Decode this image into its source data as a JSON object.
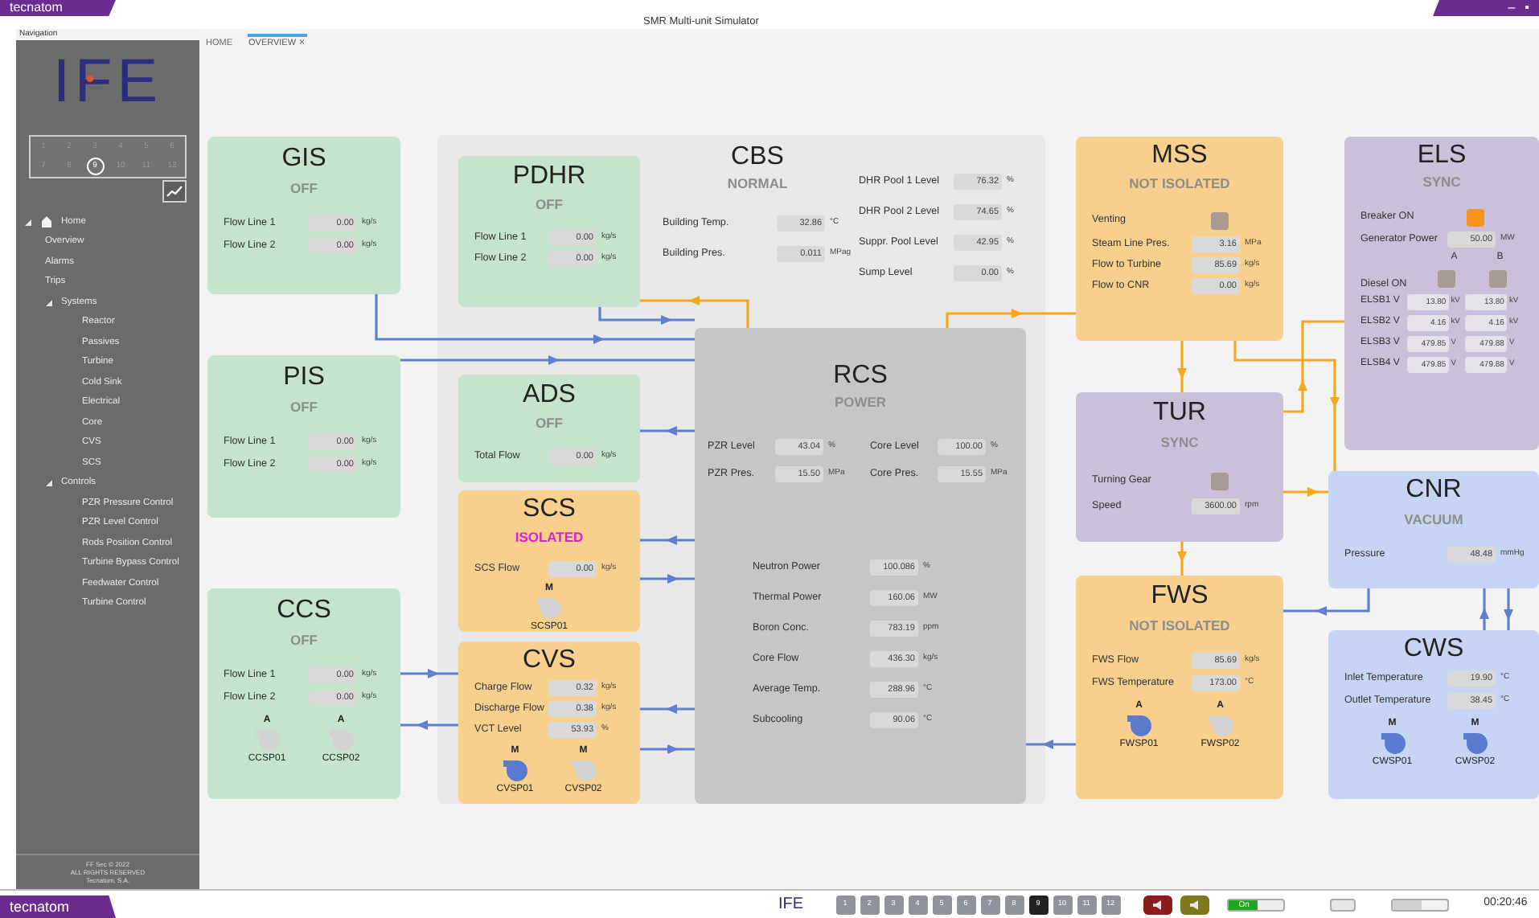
{
  "window": {
    "brand": "tecnatom",
    "title": "SMR Multi-unit Simulator",
    "controls": [
      "–",
      "▪"
    ]
  },
  "sidebar": {
    "header": "Navigation",
    "logo": "IFE",
    "units": [
      {
        "label": "1",
        "selected": false
      },
      {
        "label": "2",
        "selected": false
      },
      {
        "label": "3",
        "selected": false
      },
      {
        "label": "4",
        "selected": false
      },
      {
        "label": "5",
        "selected": false
      },
      {
        "label": "6",
        "selected": false
      },
      {
        "label": "7",
        "selected": false
      },
      {
        "label": "8",
        "selected": false
      },
      {
        "label": "9",
        "selected": true
      },
      {
        "label": "10",
        "selected": false
      },
      {
        "label": "11",
        "selected": false
      },
      {
        "label": "12",
        "selected": false
      }
    ],
    "tree": [
      {
        "label": "Home",
        "expanded": true,
        "children": [
          {
            "label": "Overview"
          },
          {
            "label": "Alarms"
          },
          {
            "label": "Trips"
          },
          {
            "label": "Systems",
            "expanded": true,
            "children": [
              {
                "label": "Reactor"
              },
              {
                "label": "Passives"
              },
              {
                "label": "Turbine"
              },
              {
                "label": "Cold Sink"
              },
              {
                "label": "Electrical"
              },
              {
                "label": "Core"
              },
              {
                "label": "CVS"
              },
              {
                "label": "SCS"
              }
            ]
          },
          {
            "label": "Controls",
            "expanded": true,
            "children": [
              {
                "label": "PZR Pressure Control"
              },
              {
                "label": "PZR Level Control"
              },
              {
                "label": "Rods Position Control"
              },
              {
                "label": "Turbine Bypass Control"
              },
              {
                "label": "Feedwater Control"
              },
              {
                "label": "Turbine Control"
              }
            ]
          }
        ]
      }
    ],
    "footer": [
      "FF Sec © 2022",
      "ALL RIGHTS RESERVED",
      "Tecnatom, S.A."
    ]
  },
  "tabs": [
    {
      "label": "HOME",
      "selected": false
    },
    {
      "label": "OVERVIEW",
      "selected": true,
      "close": "×"
    }
  ],
  "panels": [
    {
      "kind": "system",
      "title": "GIS",
      "status": "OFF",
      "status_alert": false,
      "color": "#c4e4cd",
      "rows": [
        {
          "kind": "value",
          "label": "Flow Line 1",
          "value": "0.00",
          "unit": "kg/s"
        },
        {
          "kind": "value",
          "label": "Flow Line 2",
          "value": "0.00",
          "unit": "kg/s"
        }
      ]
    },
    {
      "kind": "system",
      "title": "PIS",
      "status": "OFF",
      "status_alert": false,
      "color": "#c4e4cd",
      "rows": [
        {
          "kind": "value",
          "label": "Flow Line 1",
          "value": "0.00",
          "unit": "kg/s"
        },
        {
          "kind": "value",
          "label": "Flow Line 2",
          "value": "0.00",
          "unit": "kg/s"
        }
      ]
    },
    {
      "kind": "system",
      "title": "CCS",
      "status": "OFF",
      "status_alert": false,
      "color": "#c4e4cd",
      "rows": [
        {
          "kind": "value",
          "label": "Flow Line 1",
          "value": "0.00",
          "unit": "kg/s"
        },
        {
          "kind": "value",
          "label": "Flow Line 2",
          "value": "0.00",
          "unit": "kg/s"
        }
      ],
      "pumps": [
        {
          "mode": "A",
          "name": "CCSP01",
          "running": false
        },
        {
          "mode": "A",
          "name": "CCSP02",
          "running": false
        }
      ]
    },
    {
      "kind": "system",
      "title": "PDHR",
      "status": "OFF",
      "status_alert": false,
      "color": "#c4e4cd",
      "rows": [
        {
          "kind": "value",
          "label": "Flow Line 1",
          "value": "0.00",
          "unit": "kg/s"
        },
        {
          "kind": "value",
          "label": "Flow Line 2",
          "value": "0.00",
          "unit": "kg/s"
        }
      ]
    },
    {
      "kind": "building",
      "title": "CBS",
      "status": "NORMAL",
      "status_alert": false,
      "color": "#e8e8e8",
      "rows": [
        {
          "kind": "value",
          "label": "Building Temp.",
          "value": "32.86",
          "unit": "°C"
        },
        {
          "kind": "value",
          "label": "Building Pres.",
          "value": "0.011",
          "unit": "MPag"
        }
      ],
      "side_rows": [
        {
          "kind": "value",
          "label": "DHR Pool 1 Level",
          "value": "76.32",
          "unit": "%"
        },
        {
          "kind": "value",
          "label": "DHR Pool 2 Level",
          "value": "74.65",
          "unit": "%"
        },
        {
          "kind": "value",
          "label": "Suppr. Pool Level",
          "value": "42.95",
          "unit": "%"
        },
        {
          "kind": "value",
          "label": "Sump Level",
          "value": "0.00",
          "unit": "%"
        }
      ]
    },
    {
      "kind": "system",
      "title": "ADS",
      "status": "OFF",
      "status_alert": false,
      "color": "#c4e4cd",
      "rows": [
        {
          "kind": "value",
          "label": "Total Flow",
          "value": "0.00",
          "unit": "kg/s"
        }
      ]
    },
    {
      "kind": "system",
      "title": "SCS",
      "status": "ISOLATED",
      "status_alert": true,
      "color": "#f8d08e",
      "rows": [
        {
          "kind": "value",
          "label": "SCS Flow",
          "value": "0.00",
          "unit": "kg/s"
        }
      ],
      "pumps": [
        {
          "mode": "M",
          "name": "SCSP01",
          "running": false
        }
      ]
    },
    {
      "kind": "system",
      "title": "CVS",
      "color": "#f8d08e",
      "rows": [
        {
          "kind": "value",
          "label": "Charge Flow",
          "value": "0.32",
          "unit": "kg/s"
        },
        {
          "kind": "value",
          "label": "Discharge Flow",
          "value": "0.38",
          "unit": "kg/s"
        },
        {
          "kind": "value",
          "label": "VCT Level",
          "value": "53.93",
          "unit": "%"
        }
      ],
      "pumps": [
        {
          "mode": "M",
          "name": "CVSP01",
          "running": true
        },
        {
          "mode": "M",
          "name": "CVSP02",
          "running": false
        }
      ]
    },
    {
      "kind": "core",
      "title": "RCS",
      "status": "POWER",
      "status_alert": false,
      "color": "#c6c6c6",
      "rows": [
        {
          "kind": "value",
          "label": "PZR Level",
          "value": "43.04",
          "unit": "%"
        },
        {
          "kind": "value",
          "label": "Core Level",
          "value": "100.00",
          "unit": "%"
        },
        {
          "kind": "value",
          "label": "PZR Pres.",
          "value": "15.50",
          "unit": "MPa"
        },
        {
          "kind": "value",
          "label": "Core Pres.",
          "value": "15.55",
          "unit": "MPa"
        }
      ],
      "side_rows": [
        {
          "kind": "value",
          "label": "Neutron Power",
          "value": "100.086",
          "unit": "%"
        },
        {
          "kind": "value",
          "label": "Thermal Power",
          "value": "160.06",
          "unit": "MW"
        },
        {
          "kind": "value",
          "label": "Boron Conc.",
          "value": "783.19",
          "unit": "ppm"
        },
        {
          "kind": "value",
          "label": "Core Flow",
          "value": "436.30",
          "unit": "kg/s"
        },
        {
          "kind": "value",
          "label": "Average Temp.",
          "value": "288.96",
          "unit": "°C"
        },
        {
          "kind": "value",
          "label": "Subcooling",
          "value": "90.06",
          "unit": "°C"
        }
      ]
    },
    {
      "kind": "system",
      "title": "MSS",
      "status": "NOT ISOLATED",
      "status_alert": false,
      "color": "#f8d08e",
      "rows": [
        {
          "kind": "indicator",
          "label": "Venting",
          "on": false
        },
        {
          "kind": "value",
          "label": "Steam Line Pres.",
          "value": "3.16",
          "unit": "MPa"
        },
        {
          "kind": "value",
          "label": "Flow to Turbine",
          "value": "85.69",
          "unit": "kg/s"
        },
        {
          "kind": "value",
          "label": "Flow to CNR",
          "value": "0.00",
          "unit": "kg/s"
        }
      ]
    },
    {
      "kind": "system",
      "title": "TUR",
      "status": "SYNC",
      "status_alert": false,
      "color": "#cbc0d9",
      "rows": [
        {
          "kind": "indicator",
          "label": "Turning Gear",
          "on": false
        },
        {
          "kind": "value",
          "label": "Speed",
          "value": "3600.00",
          "unit": "rpm"
        }
      ]
    },
    {
      "kind": "system",
      "title": "FWS",
      "status": "NOT ISOLATED",
      "status_alert": false,
      "color": "#f8d08e",
      "rows": [
        {
          "kind": "value",
          "label": "FWS Flow",
          "value": "85.69",
          "unit": "kg/s"
        },
        {
          "kind": "value",
          "label": "FWS Temperature",
          "value": "173.00",
          "unit": "°C"
        }
      ],
      "pumps": [
        {
          "mode": "A",
          "name": "FWSP01",
          "running": true
        },
        {
          "mode": "A",
          "name": "FWSP02",
          "running": false
        }
      ]
    },
    {
      "kind": "system",
      "title": "ELS",
      "status": "SYNC",
      "status_alert": false,
      "color": "#cbc0d9",
      "rows": [
        {
          "kind": "indicator",
          "label": "Breaker ON",
          "on": true
        },
        {
          "kind": "value",
          "label": "Generator Power",
          "value": "50.00",
          "unit": "MW"
        },
        {
          "kind": "header",
          "labels": [
            "A",
            "B"
          ]
        },
        {
          "kind": "dual_indicator",
          "label": "Diesel ON",
          "indicators": [
            {
              "on": false
            },
            {
              "on": false
            }
          ]
        },
        {
          "kind": "dual",
          "label": "ELSB1 V",
          "values": [
            {
              "value": "13.80",
              "unit": "kV"
            },
            {
              "value": "13.80",
              "unit": "kV"
            }
          ]
        },
        {
          "kind": "dual",
          "label": "ELSB2 V",
          "values": [
            {
              "value": "4.16",
              "unit": "kV"
            },
            {
              "value": "4.16",
              "unit": "kV"
            }
          ]
        },
        {
          "kind": "dual",
          "label": "ELSB3 V",
          "values": [
            {
              "value": "479.85",
              "unit": "V"
            },
            {
              "value": "479.88",
              "unit": "V"
            }
          ]
        },
        {
          "kind": "dual",
          "label": "ELSB4 V",
          "values": [
            {
              "value": "479.85",
              "unit": "V"
            },
            {
              "value": "479.88",
              "unit": "V"
            }
          ]
        }
      ]
    },
    {
      "kind": "system",
      "title": "CNR",
      "status": "VACUUM",
      "status_alert": false,
      "color": "#c6d5f3",
      "rows": [
        {
          "kind": "value",
          "label": "Pressure",
          "value": "48.48",
          "unit": "mmHg"
        }
      ]
    },
    {
      "kind": "system",
      "title": "CWS",
      "color": "#c6d5f3",
      "rows": [
        {
          "kind": "value",
          "label": "Inlet Temperature",
          "value": "19.90",
          "unit": "°C"
        },
        {
          "kind": "value",
          "label": "Outlet Temperature",
          "value": "38.45",
          "unit": "°C"
        }
      ],
      "pumps": [
        {
          "mode": "M",
          "name": "CWSP01",
          "running": true
        },
        {
          "mode": "M",
          "name": "CWSP02",
          "running": true
        }
      ]
    }
  ],
  "taskbar": {
    "brand": "tecnatom",
    "logo": "IFE",
    "units": [
      {
        "label": "1",
        "selected": false
      },
      {
        "label": "2",
        "selected": false
      },
      {
        "label": "3",
        "selected": false
      },
      {
        "label": "4",
        "selected": false
      },
      {
        "label": "5",
        "selected": false
      },
      {
        "label": "6",
        "selected": false
      },
      {
        "label": "7",
        "selected": false
      },
      {
        "label": "8",
        "selected": false
      },
      {
        "label": "9",
        "selected": true
      },
      {
        "label": "10",
        "selected": false
      },
      {
        "label": "11",
        "selected": false
      },
      {
        "label": "12",
        "selected": false
      }
    ],
    "toggle": {
      "label": "On",
      "on": true
    },
    "switch": {
      "on": false
    },
    "time": "00:20:46"
  }
}
